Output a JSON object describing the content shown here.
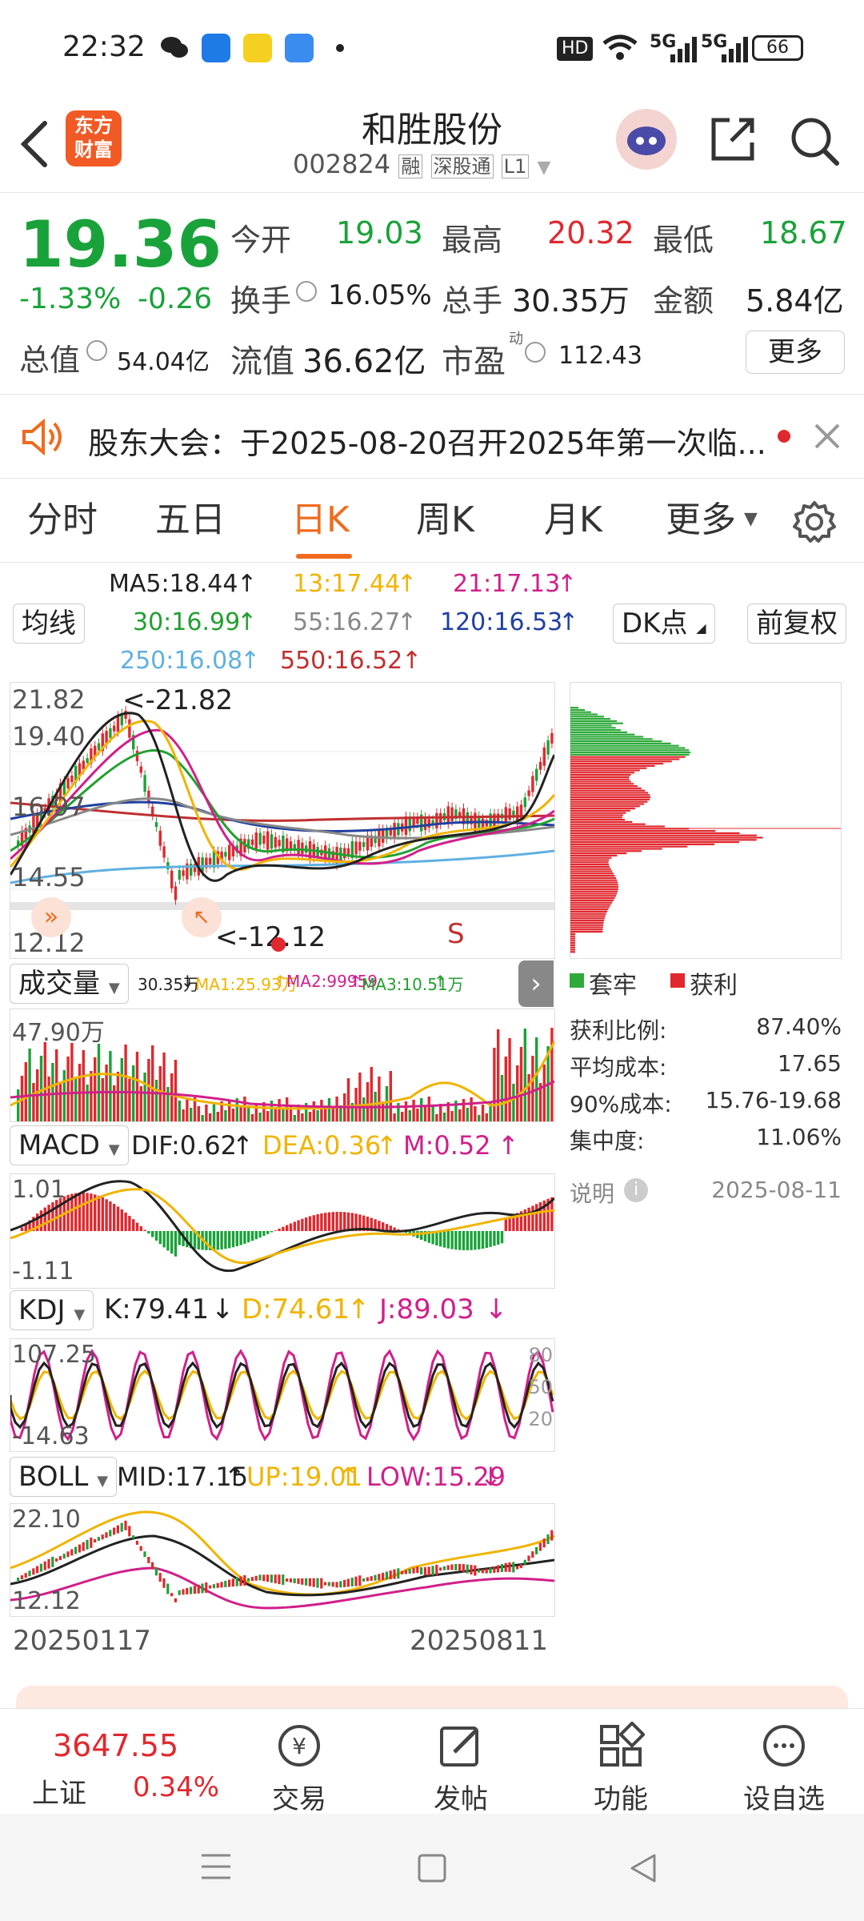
{
  "status_bar": {
    "time": "22:32",
    "battery": "66",
    "net1": "5G",
    "net2": "5G",
    "hd": "HD"
  },
  "header": {
    "logo_line1": "东方",
    "logo_line2": "财富",
    "title": "和胜股份",
    "code": "002824",
    "tag1": "融",
    "tag2": "深股通",
    "tag3": "L1"
  },
  "quote": {
    "price": "19.36",
    "change_pct": "-1.33%",
    "change": "-0.26",
    "open_label": "今开",
    "open": "19.03",
    "high_label": "最高",
    "high": "20.32",
    "low_label": "最低",
    "low": "18.67",
    "turnover_label": "换手",
    "turnover": "16.05%",
    "volume_label": "总手",
    "volume": "30.35万",
    "amount_label": "金额",
    "amount": "5.84亿",
    "mktcap_label": "总值",
    "mktcap": "54.04亿",
    "float_label": "流值",
    "float": "36.62亿",
    "pe_label": "市盈",
    "pe_sup": "动",
    "pe": "112.43",
    "more": "更多"
  },
  "notice": {
    "text": "股东大会：于2025-08-20召开2025年第一次临..."
  },
  "tabs": [
    {
      "label": "分时"
    },
    {
      "label": "五日"
    },
    {
      "label": "日K"
    },
    {
      "label": "周K"
    },
    {
      "label": "月K"
    },
    {
      "label": "更多"
    }
  ],
  "ma_legend": {
    "ma5": "MA5:18.44",
    "ma13": "13:17.44",
    "ma21": "21:17.13",
    "ma30": "30:16.99",
    "ma55": "55:16.27",
    "ma120": "120:16.53",
    "ma250": "250:16.08",
    "ma550": "550:16.52",
    "ma_button": "均线",
    "dk_button": "DK点",
    "fq_button": "前复权"
  },
  "kline": {
    "labels": [
      "21.82",
      "19.40",
      "16.97",
      "14.55",
      "12.12"
    ],
    "max_mark": "<-21.82",
    "min_mark": "<-12.12",
    "s_mark": "S",
    "colors": {
      "up": "#e0282e",
      "down": "#1aa23a",
      "ma5": "#222222",
      "ma13": "#f0b400",
      "ma21": "#d0208a",
      "ma30": "#22a030",
      "ma55": "#888888",
      "ma120": "#2040a0",
      "ma250": "#60b0e0",
      "ma550": "#c03030"
    }
  },
  "volume": {
    "button": "成交量",
    "legend_vol": "30.35万",
    "ma1": "MA1:25.93万",
    "ma2": "MA2:99959",
    "ma3": "MA3:10.51万",
    "max": "47.90万"
  },
  "macd": {
    "button": "MACD",
    "dif": "DIF:0.62",
    "dea": "DEA:0.36",
    "m": "M:0.52",
    "top": "1.01",
    "bottom": "-1.11"
  },
  "kdj": {
    "button": "KDJ",
    "k": "K:79.41",
    "d": "D:74.61",
    "j": "J:89.03",
    "top": "107.25",
    "bottom": "-14.63",
    "r80": "80",
    "r50": "50",
    "r20": "20"
  },
  "boll": {
    "button": "BOLL",
    "mid": "MID:17.15",
    "up": "UP:19.01",
    "low": "LOW:15.29",
    "top": "22.10",
    "bottom": "12.12"
  },
  "dates": {
    "start": "20250117",
    "end": "20250811"
  },
  "chip": {
    "legend_lock": "套牢",
    "legend_profit": "获利",
    "rows": [
      {
        "label": "获利比例:",
        "value": "87.40%"
      },
      {
        "label": "平均成本:",
        "value": "17.65"
      },
      {
        "label": "90%成本:",
        "value": "15.76-19.68"
      },
      {
        "label": "集中度:",
        "value": "11.06%"
      }
    ],
    "note_label": "说明",
    "note_date": "2025-08-11"
  },
  "bottom_nav": {
    "index_value": "3647.55",
    "index_name": "上证",
    "index_change": "0.34%",
    "trade": "交易",
    "post": "发帖",
    "func": "功能",
    "watch": "设自选"
  }
}
